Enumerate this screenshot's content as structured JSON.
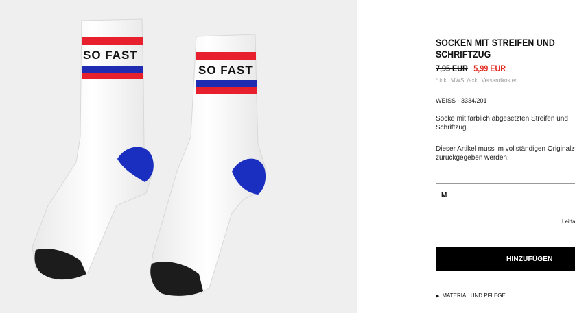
{
  "product": {
    "image_alt_text": "SO FAST",
    "title": "SOCKEN MIT STREIFEN UND SCHRIFTZUG",
    "old_price": "7,95 EUR",
    "new_price": "5,99 EUR",
    "tax_note": "* inkl. MWSt./exkl. Versandkosten.",
    "variant": "WEISS - 3334/201",
    "description": "Socke mit farblich abgesetzten Streifen und Schriftzug.",
    "return_note": "Dieser Artikel muss im vollständigen Originalzustand zurückgegeben werden.",
    "size_value": "M",
    "size_guide": "Leitfaden",
    "add_to_cart": "HINZUFÜGEN",
    "material_label": "MATERIAL UND PFLEGE"
  },
  "colors": {
    "image_bg": "#efefef",
    "price_sale": "#e2231a",
    "button_bg": "#000000",
    "sock_red": "#e8202e",
    "sock_blue": "#1f2bb0",
    "sock_heel_blue": "#1a2ec0",
    "sock_toe": "#1c1c1c"
  }
}
